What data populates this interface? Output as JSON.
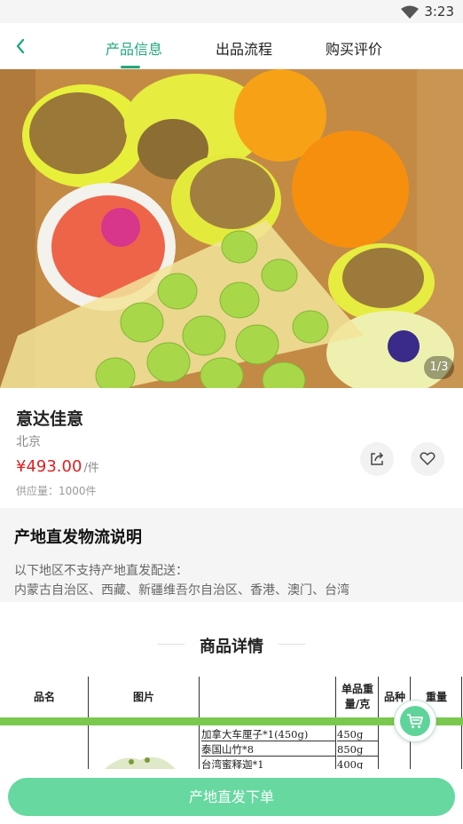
{
  "status_bar": {
    "time": "3:23"
  },
  "nav": {
    "tabs": [
      {
        "label": "产品信息",
        "active": true
      },
      {
        "label": "出品流程",
        "active": false
      },
      {
        "label": "购买评价",
        "active": false
      }
    ],
    "accent_color": "#20a87e"
  },
  "gallery": {
    "counter": "1/3"
  },
  "product": {
    "name": "意达佳意",
    "origin": "北京",
    "price": "¥493.00",
    "unit": "/件",
    "supply": "供应量：1000件",
    "price_color": "#e02020"
  },
  "logistics": {
    "title": "产地直发物流说明",
    "line1": "以下地区不支持产地直发配送：",
    "line2": "内蒙古自治区、西藏、新疆维吾尔自治区、香港、澳门、台湾"
  },
  "details": {
    "title": "商品详情",
    "table": {
      "headers": [
        "品名",
        "图片",
        "单品重量/克",
        "品种",
        "重量"
      ],
      "rows": [
        {
          "item": "加拿大车厘子*1(450g)",
          "weight": "450g"
        },
        {
          "item": "泰国山竹*8",
          "weight": "850g"
        },
        {
          "item": "台湾蜜释迦*1",
          "weight": "400g"
        }
      ]
    }
  },
  "footer": {
    "order_button": "产地直发下单",
    "button_color": "#66d8a0"
  }
}
